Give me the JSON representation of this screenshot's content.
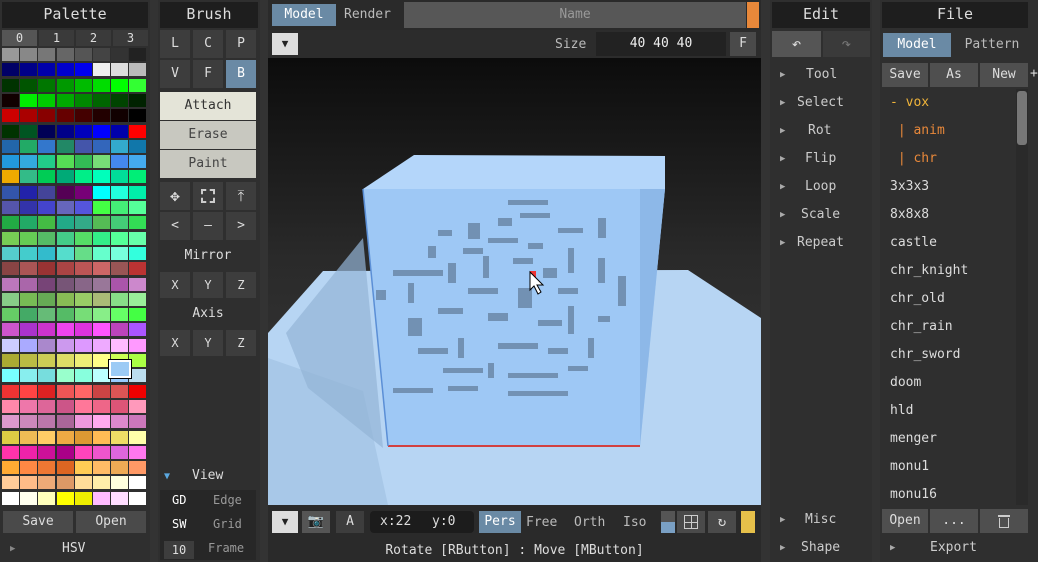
{
  "palette": {
    "title": "Palette",
    "tabs": [
      "0",
      "1",
      "2",
      "3"
    ],
    "save_label": "Save",
    "open_label": "Open",
    "hsv_label": "HSV",
    "selected_color": "#9ccbf5"
  },
  "brush": {
    "title": "Brush",
    "tools_row1": [
      "L",
      "C",
      "P"
    ],
    "tools_row2": [
      "V",
      "F",
      "B"
    ],
    "attach": "Attach",
    "erase": "Erase",
    "paint": "Paint",
    "mirror_label": "Mirror",
    "mirror_xyz": [
      "X",
      "Y",
      "Z"
    ],
    "axis_label": "Axis",
    "axis_xyz": [
      "X",
      "Y",
      "Z"
    ],
    "gd": "GD",
    "edge": "Edge",
    "sw": "SW",
    "grid": "Grid",
    "frame_num": "10",
    "frame": "Frame"
  },
  "viewport": {
    "tab_model": "Model",
    "tab_render": "Render",
    "name_placeholder": "Name",
    "size_label": "Size",
    "size_value": "40 40 40",
    "f_button": "F",
    "a_button": "A",
    "coords_x": "x:22",
    "coords_y": "y:0",
    "view_modes": [
      "Pers",
      "Free",
      "Orth",
      "Iso"
    ],
    "status": "Rotate [RButton] : Move [MButton]"
  },
  "edit": {
    "title": "Edit",
    "items": [
      "Tool",
      "Select",
      "Rot",
      "Flip",
      "Loop",
      "Scale",
      "Repeat"
    ],
    "bottom_items": [
      "Misc",
      "Shape"
    ]
  },
  "file": {
    "title": "File",
    "tab_model": "Model",
    "tab_pattern": "Pattern",
    "save": "Save",
    "as": "As",
    "new": "New",
    "plus": "+",
    "tree": [
      "- vox",
      " | anim",
      " | chr"
    ],
    "files": [
      "3x3x3",
      "8x8x8",
      "castle",
      "chr_knight",
      "chr_old",
      "chr_rain",
      "chr_sword",
      "doom",
      "hld",
      "menger",
      "monu1",
      "monu16"
    ],
    "open": "Open",
    "dots": "...",
    "export": "Export"
  }
}
